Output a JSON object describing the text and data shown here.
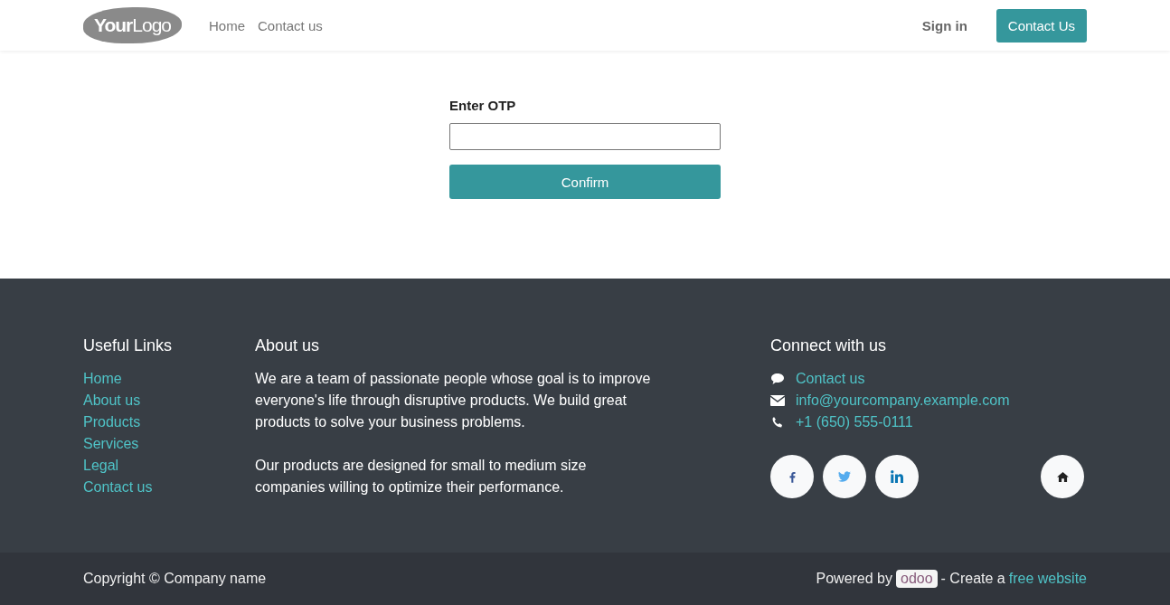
{
  "header": {
    "logo": {
      "bold": "Your",
      "light": "Logo"
    },
    "nav": [
      {
        "label": "Home"
      },
      {
        "label": "Contact us"
      }
    ],
    "sign_in": "Sign in",
    "cta": "Contact Us"
  },
  "form": {
    "label": "Enter OTP",
    "button": "Confirm"
  },
  "footer": {
    "useful_links": {
      "title": "Useful Links",
      "items": [
        "Home",
        "About us",
        "Products",
        "Services",
        "Legal",
        "Contact us"
      ]
    },
    "about": {
      "title": "About us",
      "paragraphs": [
        "We are a team of passionate people whose goal is to improve everyone's life through disruptive products. We build great products to solve your business problems.",
        "Our products are designed for small to medium size companies willing to optimize their performance."
      ]
    },
    "connect": {
      "title": "Connect with us",
      "items": [
        {
          "kind": "chat",
          "text": "Contact us"
        },
        {
          "kind": "mail",
          "text": "info@yourcompany.example.com"
        },
        {
          "kind": "phone",
          "text": "+1 (650) 555-0111"
        }
      ],
      "social": [
        {
          "kind": "facebook"
        },
        {
          "kind": "twitter"
        },
        {
          "kind": "linkedin"
        },
        {
          "kind": "home"
        }
      ]
    }
  },
  "bottom": {
    "copyright": "Copyright © Company name",
    "powered": "Powered by",
    "brand": "odoo",
    "create": "- Create a",
    "link": "free website"
  }
}
